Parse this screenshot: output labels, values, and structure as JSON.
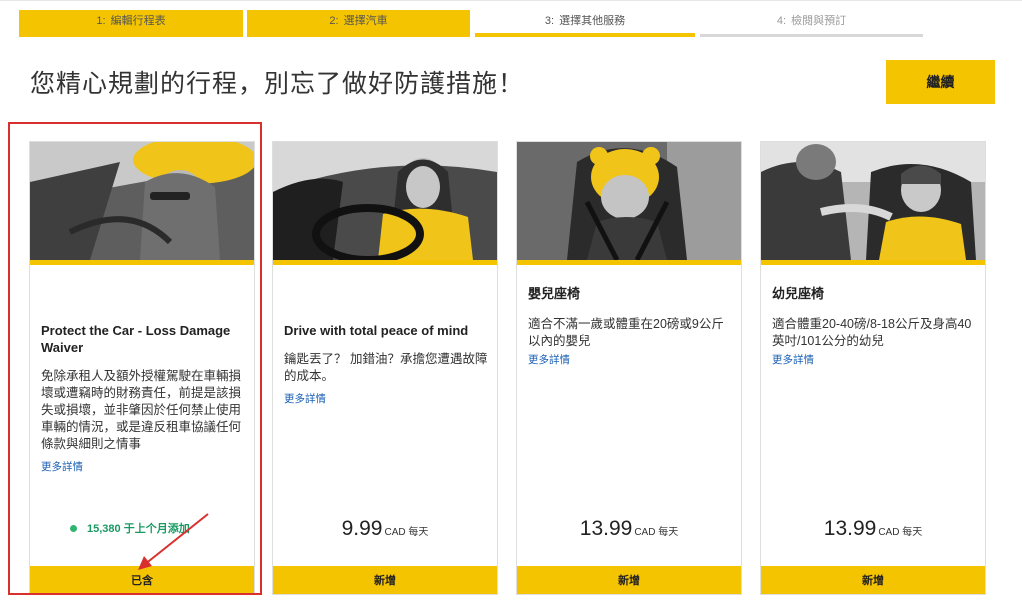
{
  "steps": [
    {
      "num": "1:",
      "label": "編輯行程表",
      "state": "done"
    },
    {
      "num": "2:",
      "label": "選擇汽車",
      "state": "done"
    },
    {
      "num": "3:",
      "label": "選擇其他服務",
      "state": "current"
    },
    {
      "num": "4:",
      "label": "檢閱與預訂",
      "state": "future"
    }
  ],
  "page": {
    "title": "您精心規劃的行程，別忘了做好防護措施！",
    "continue_label": "繼續"
  },
  "cards": [
    {
      "title": "Protect the Car - Loss Damage Waiver",
      "description": "免除承租人及額外授權駕駛在車輛損壞或遭竊時的財務責任，前提是該損失或損壞，並非肇因於任何禁止使用車輛的情況，或是違反租車協議任何條款與細則之情事",
      "more": "更多詳情",
      "social_proof": "15,380 于上个月添加",
      "button": "已含",
      "image_icon": "woman-in-car-photo"
    },
    {
      "title": "Drive with total peace of mind",
      "description": "鑰匙丟了？ 加錯油？承擔您遭遇故障的成本。",
      "more": "更多詳情",
      "price": "9.99",
      "price_unit": "CAD 每天",
      "button": "新增",
      "image_icon": "driver-smiling-photo"
    },
    {
      "title": "嬰兒座椅",
      "description": "適合不滿一歲或體重在20磅或9公斤以內的嬰兒",
      "more": "更多詳情",
      "price": "13.99",
      "price_unit": "CAD 每天",
      "button": "新增",
      "image_icon": "infant-seat-photo"
    },
    {
      "title": "幼兒座椅",
      "description": "適合體重20-40磅/8-18公斤及身高40英吋/101公分的幼兒",
      "more": "更多詳情",
      "price": "13.99",
      "price_unit": "CAD 每天",
      "button": "新增",
      "image_icon": "toddler-seat-photo"
    }
  ],
  "colors": {
    "accent": "#f5c400",
    "link": "#1a5fb4",
    "social": "#1a9a63",
    "annotation": "#d9302e"
  }
}
